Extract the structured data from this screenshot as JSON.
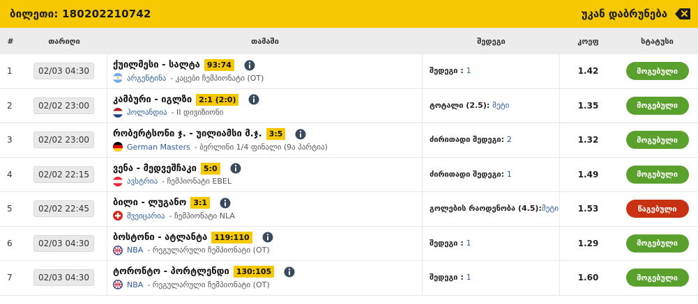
{
  "header": {
    "ticket_title": "ბილეთი: 180202210742",
    "back_label": "უკან დაბრუნება"
  },
  "columns": {
    "num": "#",
    "date": "თარიღი",
    "game": "თამაში",
    "result": "შედეგი",
    "coef": "კოეფ",
    "status": "სტატუსი"
  },
  "colors": {
    "accent": "#f5c800",
    "win": "#5aa02c",
    "lose": "#c83212",
    "link": "#2f5c9c"
  },
  "rows": [
    {
      "num": "1",
      "date": "02/03 04:30",
      "match": "ქუილმესი - სალტა",
      "score": "93:74",
      "flag_icon": "argentina-flag-icon",
      "country": "არგენტინა",
      "league": " - კაცები ჩემპიონატი (OT)",
      "result_label": "შედეგი : ",
      "result_value": "1",
      "coef": "1.42",
      "status": "მოგებული",
      "status_type": "win"
    },
    {
      "num": "2",
      "date": "02/02 23:00",
      "match": "კამბური - იგლზი",
      "score": "2:1 (2:0)",
      "flag_icon": "netherlands-flag-icon",
      "country": "ჰოლანდია",
      "league": " - II დივიზიონი",
      "result_label": "ტოტალი (2.5): ",
      "result_value": "მეტი",
      "coef": "1.35",
      "status": "მოგებული",
      "status_type": "win"
    },
    {
      "num": "3",
      "date": "02/02 23:00",
      "match": "რობერტსონი ჯ. - უილიამსი მ.ჯ.",
      "score": "3:5",
      "flag_icon": "germany-flag-icon",
      "country": "German Masters",
      "league": " - ბერლინი 1/4 ფინალი (9ა პარტია)",
      "result_label": "ძირითადი შედეგი: ",
      "result_value": "2",
      "coef": "1.32",
      "status": "მოგებული",
      "status_type": "win"
    },
    {
      "num": "4",
      "date": "02/02 22:15",
      "match": "ვენა - მედვეშჩაკი",
      "score": "5:0",
      "flag_icon": "austria-flag-icon",
      "country": "ავსტრია",
      "league": " - ჩემპიონატი EBEL",
      "result_label": "ძირითადი შედეგი: ",
      "result_value": "1",
      "coef": "1.49",
      "status": "მოგებული",
      "status_type": "win"
    },
    {
      "num": "5",
      "date": "02/02 22:45",
      "match": "ბილი - ლუგანო",
      "score": "3:1",
      "flag_icon": "switzerland-flag-icon",
      "country": "შვეიცარია",
      "league": " - ჩემპიონატი NLA",
      "result_label": "გოლების რაოდენობა (4.5):",
      "result_value": "მეტი",
      "coef": "1.53",
      "status": "წაგებული",
      "status_type": "lose"
    },
    {
      "num": "6",
      "date": "02/03 04:30",
      "match": "ბოსტონი - ატლანტა",
      "score": "119:110",
      "flag_icon": "nba-logo-icon",
      "country": "NBA",
      "league": " - რეგულარული ჩემპიონატი (OT)",
      "result_label": "შედეგი : ",
      "result_value": "1",
      "coef": "1.29",
      "status": "მოგებული",
      "status_type": "win"
    },
    {
      "num": "7",
      "date": "02/03 04:30",
      "match": "ტორონტო - პორტლენდი",
      "score": "130:105",
      "flag_icon": "nba-logo-icon",
      "country": "NBA",
      "league": " - რეგულარული ჩემპიონატი (OT)",
      "result_label": "შედეგი : ",
      "result_value": "1",
      "coef": "1.60",
      "status": "მოგებული",
      "status_type": "win"
    }
  ]
}
